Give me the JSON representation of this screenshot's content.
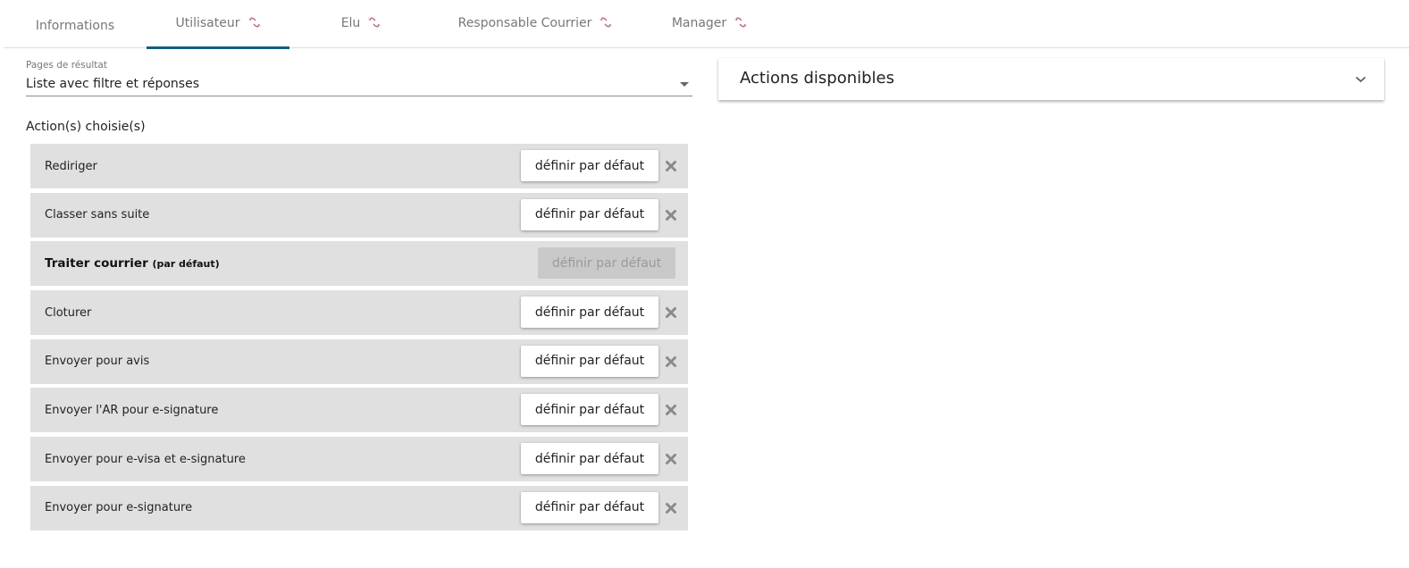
{
  "tabs": [
    {
      "label": "Informations",
      "icon": null,
      "active": false
    },
    {
      "label": "Utilisateur",
      "icon": "unlink-icon",
      "active": true
    },
    {
      "label": "Elu",
      "icon": "unlink-icon",
      "active": false
    },
    {
      "label": "Responsable Courrier",
      "icon": "unlink-icon",
      "active": false
    },
    {
      "label": "Manager",
      "icon": "unlink-icon",
      "active": false
    }
  ],
  "result_page": {
    "label": "Pages de résultat",
    "value": "Liste avec filtre et réponses"
  },
  "chosen_actions": {
    "title": "Action(s) choisie(s)",
    "set_default_label": "définir par défaut",
    "items": [
      {
        "name": "Rediriger",
        "is_default": false
      },
      {
        "name": "Classer sans suite",
        "is_default": false
      },
      {
        "name": "Traiter courrier",
        "default_suffix": "(par défaut)",
        "is_default": true
      },
      {
        "name": "Cloturer",
        "is_default": false
      },
      {
        "name": "Envoyer pour avis",
        "is_default": false
      },
      {
        "name": "Envoyer l'AR pour e-signature",
        "is_default": false
      },
      {
        "name": "Envoyer pour e-visa et e-signature",
        "is_default": false
      },
      {
        "name": "Envoyer pour e-signature",
        "is_default": false
      }
    ]
  },
  "available_actions": {
    "title": "Actions disponibles",
    "expanded": false
  },
  "colors": {
    "accent": "#135f7f",
    "row_bg": "#e0e0e0",
    "unlink_icon": "#b06a8a"
  }
}
